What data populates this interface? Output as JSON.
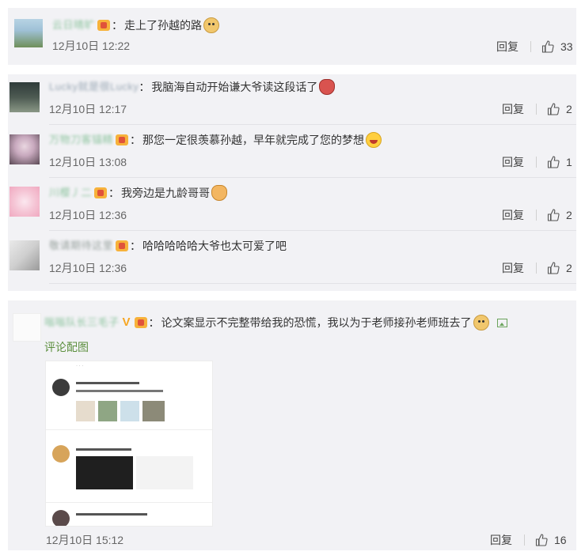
{
  "comments": [
    {
      "username": "云日晴旷",
      "text": "走上了孙越的路",
      "emoji": "doge-icon",
      "time": "12月10日 12:22",
      "reply_label": "回复",
      "likes": "33"
    },
    {
      "username": "Lucky就是很Lucky",
      "text": "我脑海自动开始谦大爷读这段话了",
      "emoji": "face-icon",
      "time": "12月10日 12:17",
      "reply_label": "回复",
      "likes": "2"
    },
    {
      "username": "万物刀客锚精",
      "text": "那您一定很羡慕孙越，早年就完成了您的梦想",
      "emoji": "laugh-icon",
      "time": "12月10日 13:08",
      "reply_label": "回复",
      "likes": "1"
    },
    {
      "username": "川樱丿二",
      "text": "我旁边是九龄哥哥",
      "emoji": "cat-icon",
      "time": "12月10日 12:36",
      "reply_label": "回复",
      "likes": "2"
    },
    {
      "username": "敬请期待这里",
      "text": "哈哈哈哈哈大爷也太可爱了吧",
      "emoji": "",
      "time": "12月10日 12:36",
      "reply_label": "回复",
      "likes": "2"
    },
    {
      "username": "嗡嗡队长三毛子",
      "text": "论文案显示不完整带给我的恐慌，我以为于老师接孙老师班去了",
      "emoji": "doge-icon",
      "picture_link": "评论配图",
      "time": "12月10日 15:12",
      "reply_label": "回复",
      "likes": "16"
    }
  ],
  "colors": {
    "card_bg": "#f2f2f5",
    "link_green": "#5c8f3e",
    "username_green": "#8fc5a0"
  }
}
